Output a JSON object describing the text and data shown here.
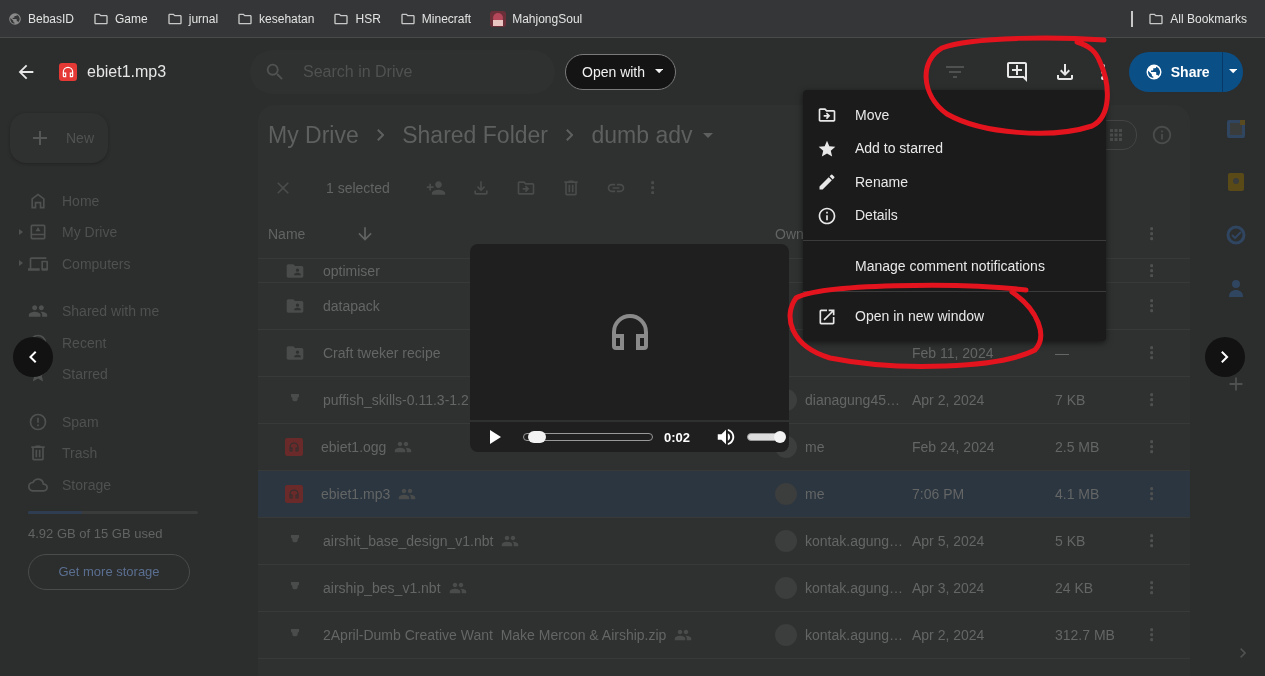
{
  "bookmarks": [
    {
      "label": "BebasID",
      "kind": "site"
    },
    {
      "label": "Game",
      "kind": "folder"
    },
    {
      "label": "jurnal",
      "kind": "folder"
    },
    {
      "label": "kesehatan",
      "kind": "folder"
    },
    {
      "label": "HSR",
      "kind": "folder"
    },
    {
      "label": "Minecraft",
      "kind": "folder"
    },
    {
      "label": "MahjongSoul",
      "kind": "app"
    }
  ],
  "all_bookmarks": "All Bookmarks",
  "preview": {
    "file_name": "ebiet1.mp3",
    "open_with": "Open with",
    "share": "Share"
  },
  "drive": {
    "search_placeholder": "Search in Drive",
    "new_button": "New",
    "sidebar": {
      "groups": [
        [
          {
            "label": "Home",
            "expandable": false
          },
          {
            "label": "My Drive",
            "expandable": true
          },
          {
            "label": "Computers",
            "expandable": true
          }
        ],
        [
          {
            "label": "Shared with me",
            "expandable": false
          },
          {
            "label": "Recent",
            "expandable": false
          },
          {
            "label": "Starred",
            "expandable": false
          }
        ],
        [
          {
            "label": "Spam",
            "expandable": false
          },
          {
            "label": "Trash",
            "expandable": false
          },
          {
            "label": "Storage",
            "expandable": false
          }
        ]
      ]
    },
    "storage": {
      "level": 0.32,
      "text": "4.92 GB of 15 GB used"
    },
    "get_more_storage": "Get more storage",
    "breadcrumb": [
      "My Drive",
      "Shared Folder",
      "dumb adv"
    ],
    "selection": "1 selected",
    "columns": [
      "Name",
      "Own"
    ],
    "rows": [
      {
        "name": "optimiser",
        "kind": "folder",
        "shared": false,
        "selected": false
      },
      {
        "name": "datapack",
        "kind": "folder",
        "shared": false,
        "selected": false
      },
      {
        "name": "Craft tweker recipe",
        "kind": "folder",
        "shared": false,
        "selected": false,
        "date": "Feb 11, 2024",
        "size": "—"
      },
      {
        "name": "puffish_skills-0.11.3-1.2",
        "kind": "file",
        "shared": false,
        "selected": false,
        "owner": "dianagung45…",
        "date": "Apr 2, 2024",
        "size": "7 KB"
      },
      {
        "name": "ebiet1.ogg",
        "kind": "audio",
        "shared": true,
        "selected": false,
        "owner": "me",
        "date": "Feb 24, 2024",
        "size": "2.5 MB"
      },
      {
        "name": "ebiet1.mp3",
        "kind": "audio",
        "shared": true,
        "selected": true,
        "owner": "me",
        "date": "7:06 PM",
        "size": "4.1 MB"
      },
      {
        "name": "airshit_base_design_v1.nbt",
        "kind": "file",
        "shared": true,
        "selected": false,
        "owner": "kontak.agung…",
        "date": "Apr 5, 2024",
        "size": "5 KB"
      },
      {
        "name": "airship_bes_v1.nbt",
        "kind": "file",
        "shared": true,
        "selected": false,
        "owner": "kontak.agung…",
        "date": "Apr 3, 2024",
        "size": "24 KB"
      },
      {
        "name": "2April-Dumb Creative Want  Make Mercon & Airship.zip",
        "kind": "file",
        "shared": true,
        "selected": false,
        "owner": "kontak.agung…",
        "date": "Apr 2, 2024",
        "size": "312.7 MB"
      }
    ]
  },
  "player": {
    "time": "0:02",
    "progress": {
      "level": 0.05
    },
    "volume": {
      "level": 0.88
    }
  },
  "menu": {
    "items": [
      {
        "kind": "item",
        "label": "Move"
      },
      {
        "kind": "item",
        "label": "Add to starred"
      },
      {
        "kind": "item",
        "label": "Rename"
      },
      {
        "kind": "item",
        "label": "Details"
      },
      {
        "kind": "divider"
      },
      {
        "kind": "item",
        "label": "Manage comment notifications"
      },
      {
        "kind": "divider"
      },
      {
        "kind": "item",
        "label": "Open in new window"
      }
    ]
  }
}
